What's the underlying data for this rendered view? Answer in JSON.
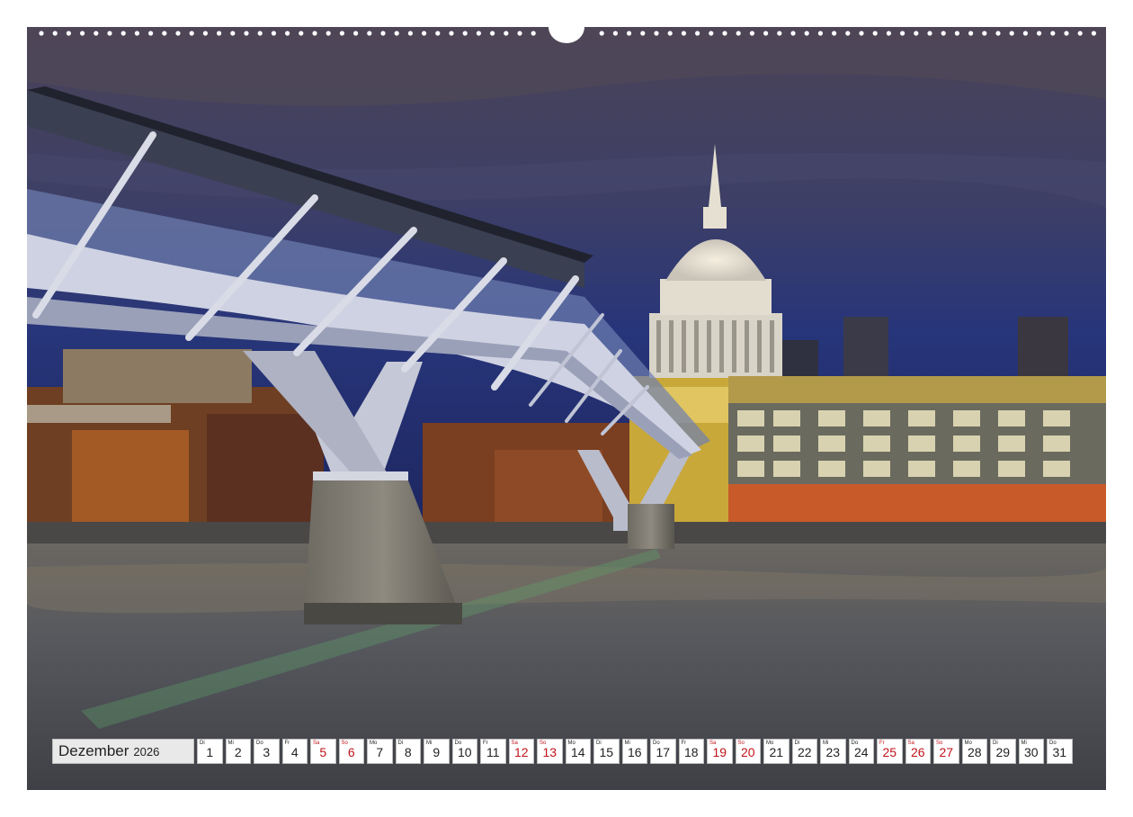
{
  "calendar": {
    "month": "Dezember",
    "year": "2026",
    "days": [
      {
        "wd": "Di",
        "num": "1",
        "we": false
      },
      {
        "wd": "Mi",
        "num": "2",
        "we": false
      },
      {
        "wd": "Do",
        "num": "3",
        "we": false
      },
      {
        "wd": "Fr",
        "num": "4",
        "we": false
      },
      {
        "wd": "Sa",
        "num": "5",
        "we": true
      },
      {
        "wd": "So",
        "num": "6",
        "we": true
      },
      {
        "wd": "Mo",
        "num": "7",
        "we": false
      },
      {
        "wd": "Di",
        "num": "8",
        "we": false
      },
      {
        "wd": "Mi",
        "num": "9",
        "we": false
      },
      {
        "wd": "Do",
        "num": "10",
        "we": false
      },
      {
        "wd": "Fr",
        "num": "11",
        "we": false
      },
      {
        "wd": "Sa",
        "num": "12",
        "we": true
      },
      {
        "wd": "So",
        "num": "13",
        "we": true
      },
      {
        "wd": "Mo",
        "num": "14",
        "we": false
      },
      {
        "wd": "Di",
        "num": "15",
        "we": false
      },
      {
        "wd": "Mi",
        "num": "16",
        "we": false
      },
      {
        "wd": "Do",
        "num": "17",
        "we": false
      },
      {
        "wd": "Fr",
        "num": "18",
        "we": false
      },
      {
        "wd": "Sa",
        "num": "19",
        "we": true
      },
      {
        "wd": "So",
        "num": "20",
        "we": true
      },
      {
        "wd": "Mo",
        "num": "21",
        "we": false
      },
      {
        "wd": "Di",
        "num": "22",
        "we": false
      },
      {
        "wd": "Mi",
        "num": "23",
        "we": false
      },
      {
        "wd": "Do",
        "num": "24",
        "we": false
      },
      {
        "wd": "Fr",
        "num": "25",
        "we": true
      },
      {
        "wd": "Sa",
        "num": "26",
        "we": true
      },
      {
        "wd": "So",
        "num": "27",
        "we": true
      },
      {
        "wd": "Mo",
        "num": "28",
        "we": false
      },
      {
        "wd": "Di",
        "num": "29",
        "we": false
      },
      {
        "wd": "Mi",
        "num": "30",
        "we": false
      },
      {
        "wd": "Do",
        "num": "31",
        "we": false
      }
    ]
  },
  "colors": {
    "weekend": "#c0131b",
    "sky": "#3a3f63",
    "water": "#5a5c62"
  }
}
